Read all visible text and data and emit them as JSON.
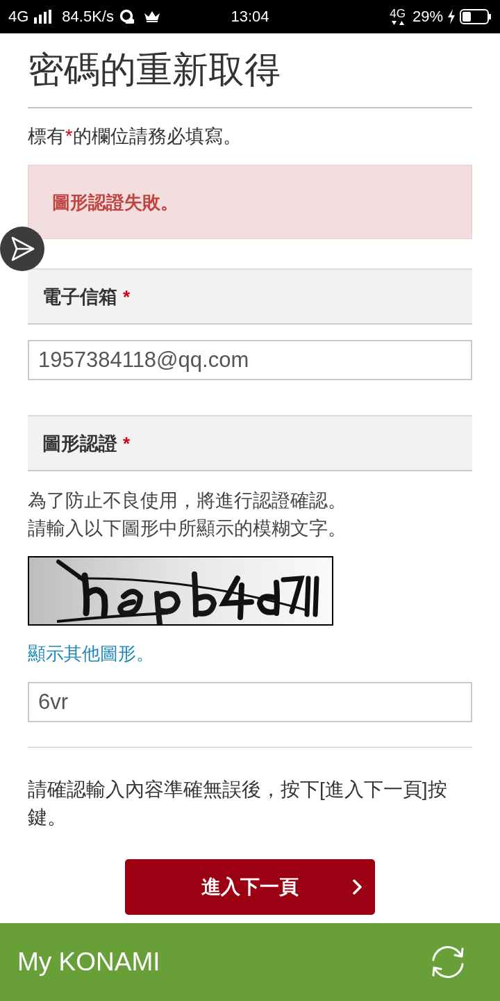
{
  "status_bar": {
    "network_left": "4G",
    "speed": "84.5K/s",
    "time": "13:04",
    "network_right": "4G",
    "battery_percent": "29%",
    "charging": true
  },
  "page": {
    "title": "密碼的重新取得",
    "required_note": {
      "before": "標有",
      "mark": "*",
      "after": "的欄位請務必填寫。"
    },
    "error_message": "圖形認證失敗。"
  },
  "sections": [
    {
      "kind": "email",
      "label": "電子信箱",
      "required_mark": "*",
      "value": "1957384118@qq.com"
    },
    {
      "kind": "captcha",
      "label": "圖形認證",
      "required_mark": "*",
      "instructions": [
        "為了防止不良使用，將進行認證確認。",
        "請輸入以下圖形中所顯示的模糊文字。"
      ],
      "refresh_link": "顯示其他圖形。",
      "value": "6vr"
    }
  ],
  "confirm_note": "請確認輸入內容準確無誤後，按下[進入下一頁]按鍵。",
  "submit_button": {
    "label": "進入下一頁"
  },
  "bottom_bar": {
    "title": "My KONAMI"
  }
}
